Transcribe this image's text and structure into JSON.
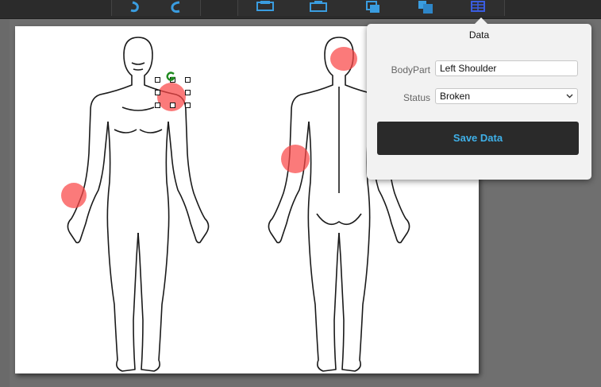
{
  "toolbar": {
    "icons": [
      "undo-icon",
      "redo-icon",
      "print-icon",
      "export-icon",
      "copy-icon",
      "layer-icon",
      "data-table-icon"
    ]
  },
  "diagram": {
    "views": [
      "front-body",
      "back-body"
    ],
    "markers": [
      {
        "name": "front-left-shoulder",
        "selected": true
      },
      {
        "name": "front-right-forearm",
        "selected": false
      },
      {
        "name": "back-head",
        "selected": false
      },
      {
        "name": "back-left-upper-arm",
        "selected": false
      }
    ],
    "marker_color": "#fa4646"
  },
  "popover": {
    "title": "Data",
    "fields": {
      "bodypart": {
        "label": "BodyPart",
        "value": "Left Shoulder"
      },
      "status": {
        "label": "Status",
        "value": "Broken"
      }
    },
    "save_label": "Save Data",
    "save_text_color": "#3fb0e8"
  }
}
